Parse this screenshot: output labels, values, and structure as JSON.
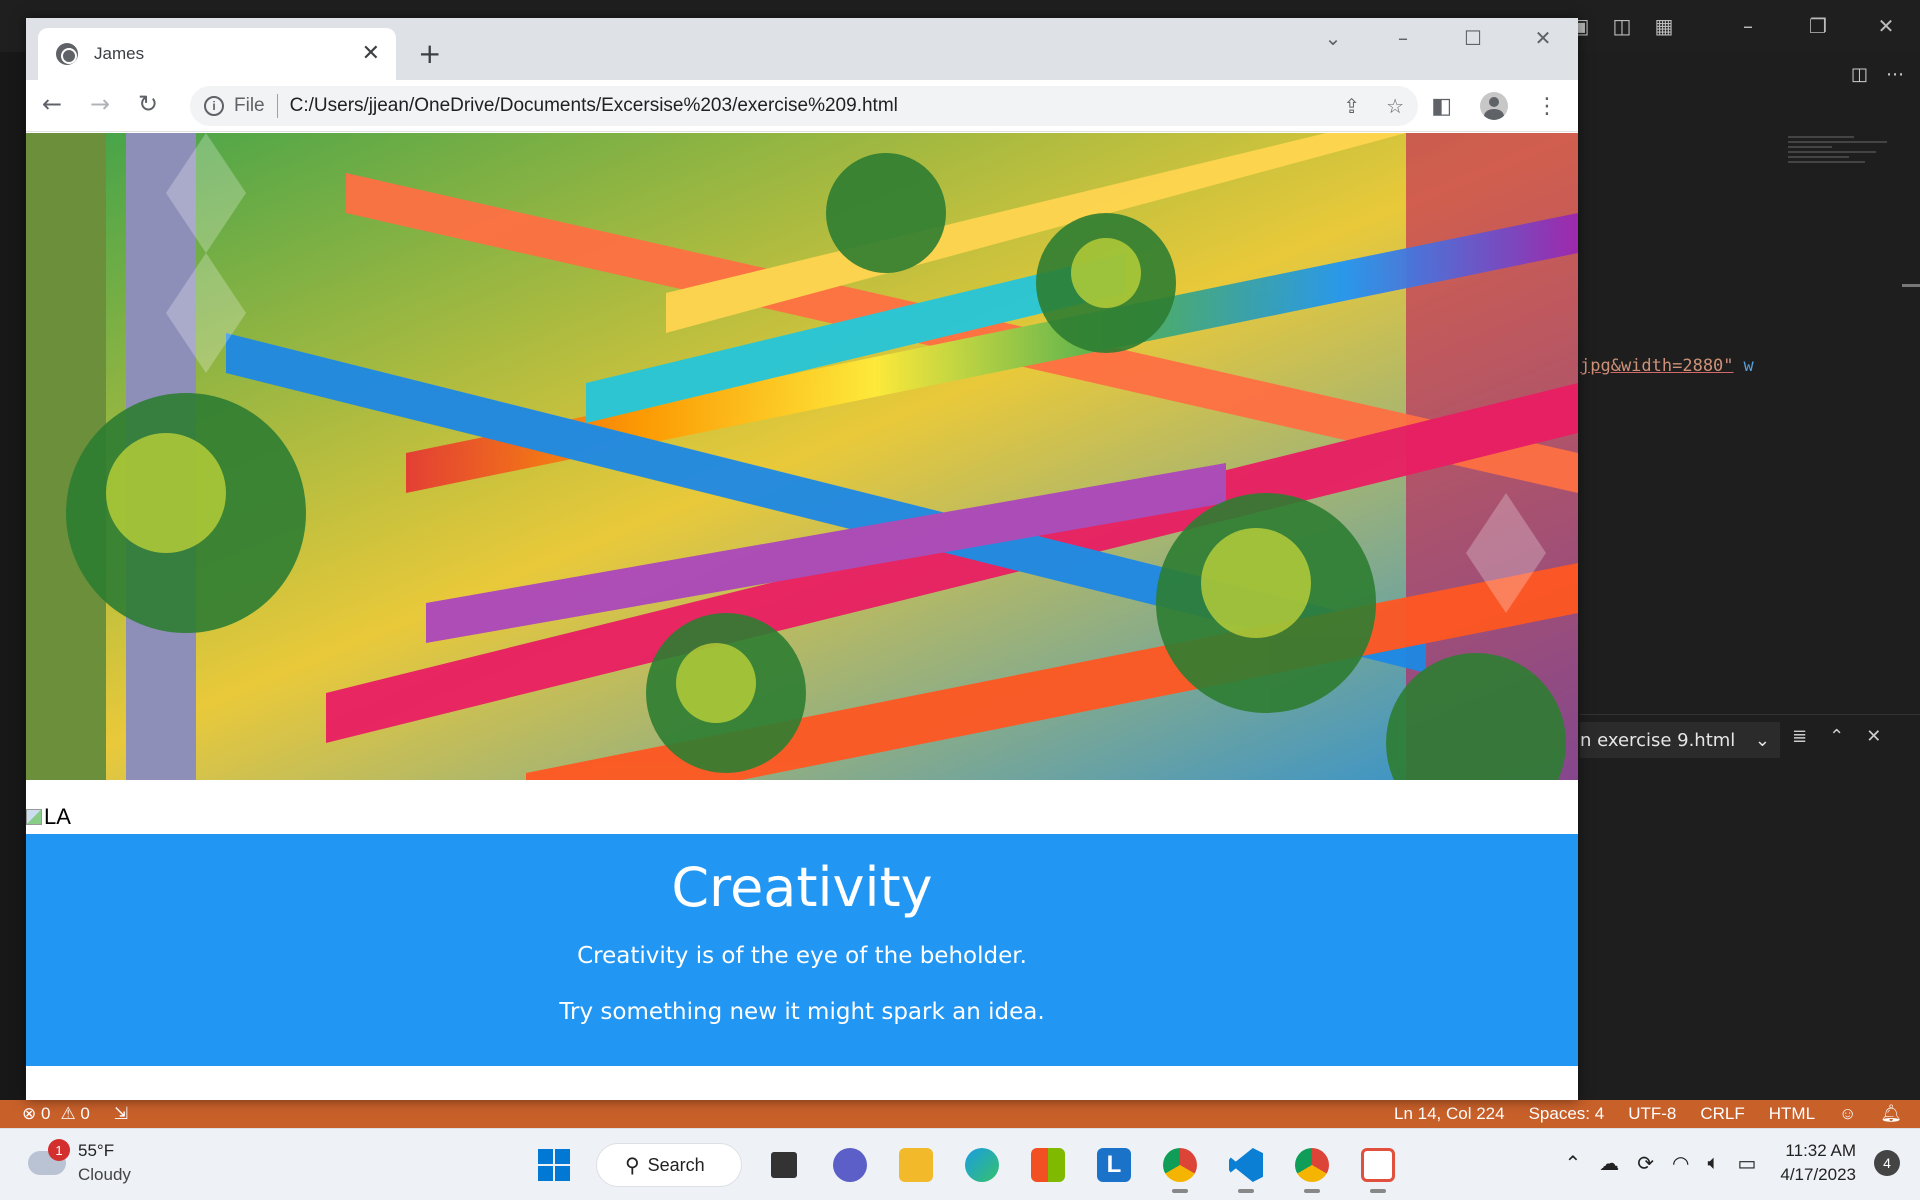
{
  "browser": {
    "tab_title": "James",
    "url_scheme_label": "File",
    "url": "C:/Users/jjean/OneDrive/Documents/Excersise%203/exercise%209.html"
  },
  "page": {
    "broken_image_alt": "LA",
    "heading": "Creativity",
    "paragraph_1": "Creativity is of the eye of the beholder.",
    "paragraph_2": "Try something new it might spark an idea.",
    "banner_color": "#2196f3"
  },
  "editor": {
    "code_fragment": "jpg&width=2880\"",
    "code_fragment_tail": "w",
    "find_widget_text": "n exercise 9.html"
  },
  "statusbar": {
    "errors": "0",
    "warnings": "0",
    "position": "Ln 14, Col 224",
    "spaces": "Spaces: 4",
    "encoding": "UTF-8",
    "eol": "CRLF",
    "language": "HTML",
    "color": "#c8602a"
  },
  "taskbar": {
    "weather_temp": "55°F",
    "weather_desc": "Cloudy",
    "weather_badge": "1",
    "search_label": "Search",
    "time": "11:32 AM",
    "date": "4/17/2023",
    "notification_count": "4"
  }
}
